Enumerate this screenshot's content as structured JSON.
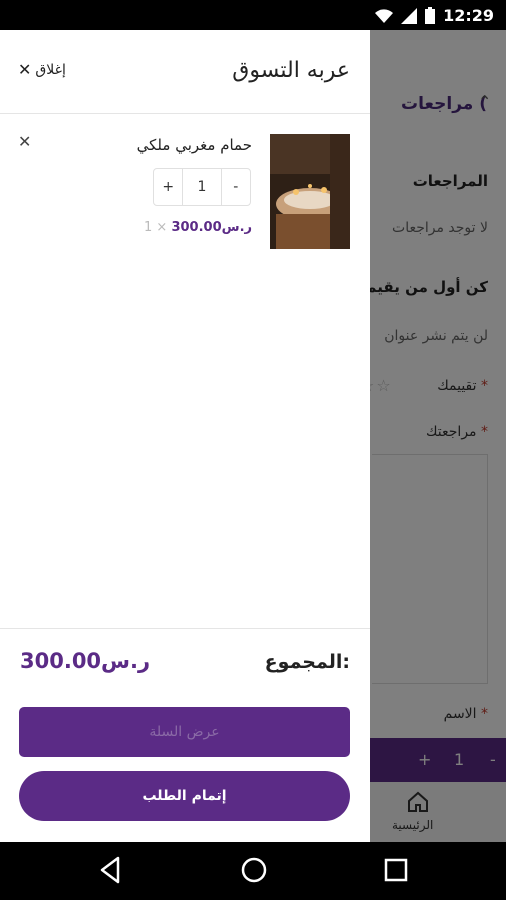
{
  "status_bar": {
    "time": "12:29"
  },
  "background": {
    "reviews_title": "مراجعات (",
    "reviews_heading": "المراجعات",
    "no_reviews": "لا توجد مراجعات",
    "be_first": "كن أول من يقيم",
    "email_note": "لن يتم نشر عنوان",
    "rating_label": "تقييمك",
    "review_label": "مراجعتك",
    "name_label": "الاسم",
    "required_mark": "*",
    "stepper": {
      "minus": "-",
      "qty": "1",
      "plus": "+"
    },
    "home_label": "الرئيسية"
  },
  "drawer": {
    "title": "عربه التسوق",
    "close_label": "إغلاق",
    "items": [
      {
        "name": "حمام مغربي ملكي",
        "quantity": "1",
        "minus": "-",
        "plus": "+",
        "qty_prefix": "1 ×",
        "price": "300.00ر.س"
      }
    ],
    "total_label": "المجموع:",
    "total_value": "300.00ر.س",
    "view_cart_label": "عرض السلة",
    "checkout_label": "إتمام الطلب"
  },
  "colors": {
    "accent": "#5b2b86"
  },
  "icons": [
    "wifi-icon",
    "signal-icon",
    "battery-icon",
    "close-icon",
    "home-icon",
    "back-icon",
    "home-circle-icon",
    "recents-icon"
  ]
}
